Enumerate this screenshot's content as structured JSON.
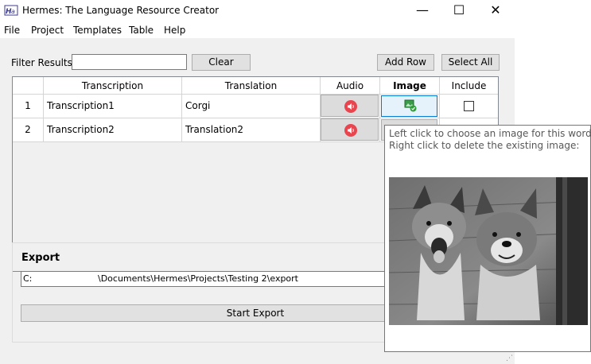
{
  "window": {
    "title": "Hermes: The Language Resource Creator",
    "minimize": "—",
    "maximize": "☐",
    "close": "✕"
  },
  "menu": [
    "File",
    "Project",
    "Templates",
    "Table",
    "Help"
  ],
  "toolbar": {
    "filter_label": "Filter Results:",
    "filter_value": "",
    "clear_label": "Clear",
    "add_row_label": "Add Row",
    "select_all_label": "Select All"
  },
  "table": {
    "columns": [
      "",
      "Transcription",
      "Translation",
      "Audio",
      "Image",
      "Include"
    ],
    "rows": [
      {
        "num": "1",
        "transcription": "Transcription1",
        "translation": "Corgi",
        "include": false
      },
      {
        "num": "2",
        "transcription": "Transcription2",
        "translation": "Translation2",
        "include": false
      }
    ]
  },
  "export": {
    "label": "Export",
    "path_prefix": "C:",
    "path_rest": "\\Documents\\Hermes\\Projects\\Testing 2\\export",
    "start_label": "Start Export"
  },
  "tooltip": {
    "line1": "Left click to choose an image for this word",
    "line2": "Right click to delete the existing image:"
  },
  "colors": {
    "accent": "#0078d7",
    "audio_icon": "#e8454f",
    "image_icon": "#2e9e3a",
    "panel_bg": "#f0f0f0"
  }
}
